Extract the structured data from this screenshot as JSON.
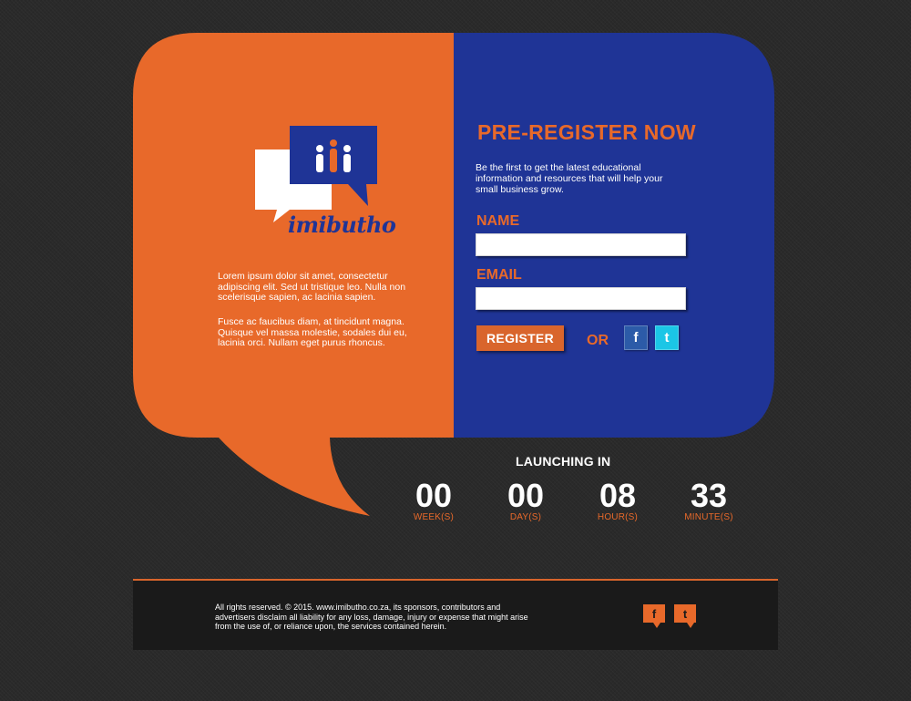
{
  "brand": {
    "name": "imibutho",
    "logo_icon": "speech-bubbles-people-icon",
    "colors": {
      "orange": "#e8692a",
      "blue": "#1f3496",
      "dark": "#2a2a2a"
    }
  },
  "intro": {
    "paragraph1": "Lorem ipsum dolor sit amet, consectetur adipiscing elit. Sed ut tristique leo. Nulla non scelerisque sapien, ac lacinia sapien.",
    "paragraph2": "Fusce ac faucibus diam, at tincidunt magna. Quisque vel massa molestie, sodales dui eu, lacinia orci. Nullam eget purus rhoncus."
  },
  "preregister": {
    "title": "PRE-REGISTER NOW",
    "description": "Be the first to get the latest educational information and resources that will help your small business grow.",
    "name_label": "NAME",
    "name_value": "",
    "email_label": "EMAIL",
    "email_value": "",
    "register_label": "REGISTER",
    "or_label": "OR",
    "facebook_glyph": "f",
    "twitter_glyph": "t"
  },
  "countdown": {
    "title": "LAUNCHING IN",
    "units": [
      {
        "value": "00",
        "label": "WEEK(S)"
      },
      {
        "value": "00",
        "label": "DAY(S)"
      },
      {
        "value": "08",
        "label": "HOUR(S)"
      },
      {
        "value": "33",
        "label": "MINUTE(S)"
      }
    ]
  },
  "footer": {
    "text": "All rights reserved. © 2015. www.imibutho.co.za, its sponsors, contributors and advertisers disclaim all liability for any loss, damage, injury or expense that might arise from the use of, or reliance upon, the services contained herein.",
    "facebook_glyph": "f",
    "twitter_glyph": "t"
  }
}
